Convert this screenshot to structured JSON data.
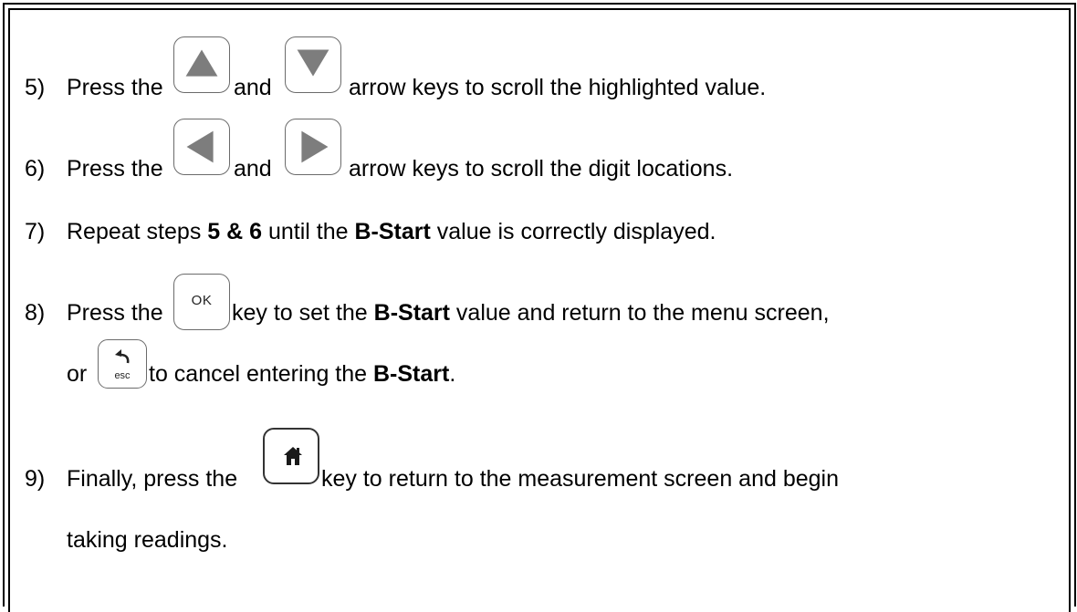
{
  "steps": {
    "s5": {
      "num": "5)",
      "a": "Press the",
      "b": "and",
      "c": "arrow keys to scroll the highlighted value."
    },
    "s6": {
      "num": "6)",
      "a": "Press the",
      "b": "and",
      "c": "arrow keys to scroll the digit locations."
    },
    "s7": {
      "num": "7)",
      "a": "Repeat steps ",
      "b1": "5 & 6",
      "c": " until the ",
      "b2": "B-Start",
      "d": " value is correctly displayed."
    },
    "s8": {
      "num": "8)",
      "a": "Press the",
      "c": " key to set the ",
      "b1": "B-Start",
      "d": " value and return to the menu screen,",
      "or": "or",
      "e": " to cancel entering the ",
      "b2": "B-Start",
      "f": "."
    },
    "s9": {
      "num": "9)",
      "a": "Finally, press the",
      "c": " key to return to the measurement screen and begin",
      "cont": "taking readings."
    }
  },
  "keys": {
    "up": {
      "icon": "up-arrow-icon"
    },
    "down": {
      "icon": "down-arrow-icon"
    },
    "left": {
      "icon": "left-arrow-icon"
    },
    "right": {
      "icon": "right-arrow-icon"
    },
    "ok": {
      "label": "OK"
    },
    "esc": {
      "label": "esc",
      "icon": "back-arrow-icon"
    },
    "home": {
      "icon": "home-icon"
    }
  },
  "colors": {
    "arrow": "#7d7d7d",
    "key_border": "#6b6b6b",
    "text": "#000000"
  }
}
